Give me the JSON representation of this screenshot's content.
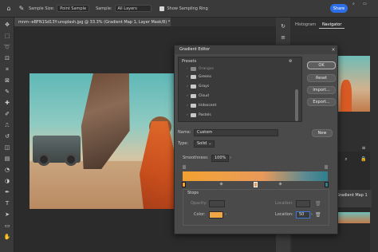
{
  "optbar": {
    "sample_size_label": "Sample Size:",
    "sample_size_value": "Point Sample",
    "sample_label": "Sample:",
    "sample_value": "All Layers",
    "show_ring_label": "Show Sampling Ring",
    "share_label": "Share"
  },
  "document": {
    "tab_title": "mnm--eBFN1Sd13Y-unsplash.jpg @ 33.3% (Gradient Map 1, Layer Mask/8) *"
  },
  "right_panel": {
    "tabs": [
      "Histogram",
      "Navigator"
    ],
    "active_tab": "Navigator",
    "layer_names": [
      "Gradient Map 1"
    ]
  },
  "dialog": {
    "title": "Gradient Editor",
    "presets": {
      "heading": "Presets",
      "items": [
        "Oranges",
        "Greens",
        "Grays",
        "Cloud",
        "Iridescent",
        "Pastels"
      ]
    },
    "buttons": {
      "ok": "OK",
      "reset": "Reset",
      "import": "Import...",
      "export": "Export...",
      "new": "New"
    },
    "name_label": "Name:",
    "name_value": "Custom",
    "type_label": "Type:",
    "type_value": "Solid",
    "smoothness_label": "Smoothness:",
    "smoothness_value": "100%",
    "stops": {
      "heading": "Stops",
      "opacity_label": "Opacity:",
      "location_label": "Location:",
      "color_label": "Color:",
      "color_location_value": "50"
    },
    "gradient_colors": [
      "#f2a030",
      "#e89a5a",
      "#2f7f8e"
    ],
    "color_swatch": "#f1a645"
  },
  "colors": {
    "accent": "#2d6ee6"
  }
}
